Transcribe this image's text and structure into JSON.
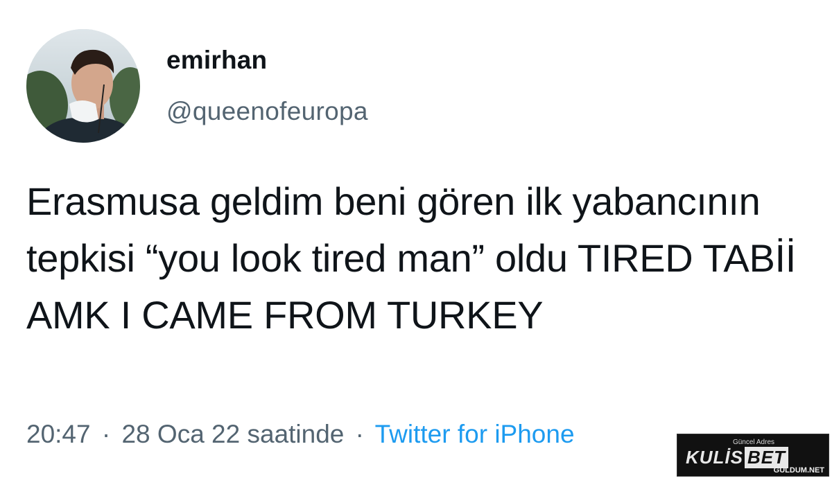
{
  "user": {
    "display_name": "emirhan",
    "handle": "@queenofeuropa"
  },
  "tweet": {
    "text": "Erasmusa geldim beni gören ilk yabancının tepkisi “you look tired man” oldu TIRED TABİİ AMK I CAME FROM TURKEY",
    "time": "20:47",
    "separator": "·",
    "date": "28 Oca 22 saatinde",
    "source": "Twitter for iPhone"
  },
  "watermark": {
    "caption": "Güncel Adres",
    "brand": "KULİS",
    "brand_suffix": "BET",
    "site": "GULDUM.NET"
  },
  "colors": {
    "text": "#0f1419",
    "secondary": "#536471",
    "link": "#1d9bf0"
  },
  "icons": {
    "avatar": "profile-photo"
  }
}
